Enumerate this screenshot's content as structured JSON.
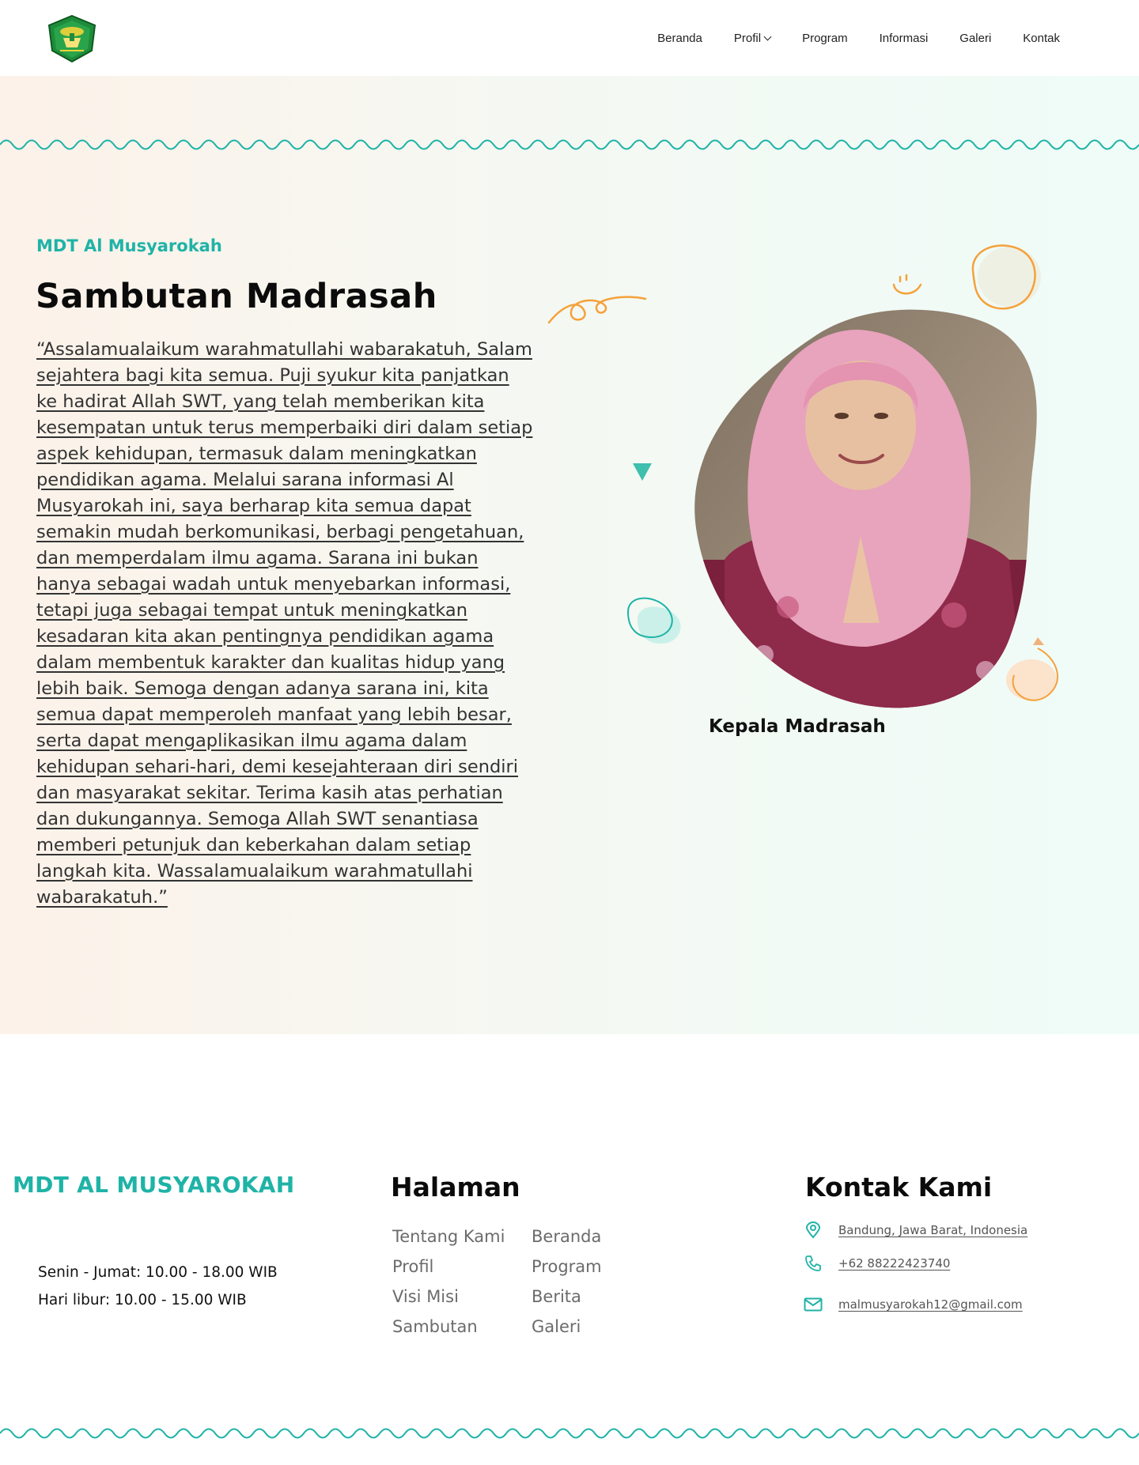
{
  "header": {
    "nav": [
      {
        "label": "Beranda"
      },
      {
        "label": "Profil"
      },
      {
        "label": "Program"
      },
      {
        "label": "Informasi"
      },
      {
        "label": "Galeri"
      },
      {
        "label": "Kontak"
      }
    ]
  },
  "sambutan": {
    "eyebrow": "MDT Al Musyarokah",
    "title": "Sambutan Madrasah",
    "quote": "“Assalamualaikum warahmatullahi wabarakatuh, Salam sejahtera bagi kita semua. Puji syukur kita panjatkan ke hadirat Allah SWT, yang telah memberikan kita kesempatan untuk terus memperbaiki diri dalam setiap aspek kehidupan, termasuk dalam meningkatkan pendidikan agama. Melalui sarana informasi Al Musyarokah ini, saya berharap kita semua dapat semakin mudah berkomunikasi, berbagi pengetahuan, dan memperdalam ilmu agama. Sarana ini bukan hanya sebagai wadah untuk menyebarkan informasi, tetapi juga sebagai tempat untuk meningkatkan kesadaran kita akan pentingnya pendidikan agama dalam membentuk karakter dan kualitas hidup yang lebih baik. Semoga dengan adanya sarana ini, kita semua dapat memperoleh manfaat yang lebih besar, serta dapat mengaplikasikan ilmu agama dalam kehidupan sehari-hari, demi kesejahteraan diri sendiri dan masyarakat sekitar. Terima kasih atas perhatian dan dukungannya. Semoga Allah SWT senantiasa memberi petunjuk dan keberkahan dalam setiap langkah kita. Wassalamualaikum warahmatullahi wabarakatuh.”",
    "caption": "Kepala Madrasah"
  },
  "footer": {
    "brand": "MDT AL MUSYAROKAH",
    "hours": [
      "Senin - Jumat: 10.00 - 18.00 WIB",
      "Hari libur: 10.00 - 15.00 WIB"
    ],
    "pages_heading": "Halaman",
    "pages": [
      "Tentang Kami",
      "Beranda",
      "Profil",
      "Program",
      "Visi Misi",
      "Berita",
      "Sambutan",
      "Galeri"
    ],
    "contact_heading": "Kontak Kami",
    "address": "Bandung, Jawa Barat, Indonesia",
    "phone": "+62 88222423740",
    "email": "malmusyarokah12@gmail.com"
  },
  "colors": {
    "accent": "#1fb3a7",
    "orange": "#f5a13a",
    "text": "#111111",
    "muted": "#6b6b6b"
  },
  "icons": {
    "logo": "kemenag-emblem",
    "nav_dropdown": "chevron-down-icon",
    "address": "map-pin-icon",
    "phone": "phone-icon",
    "email": "mail-icon"
  }
}
